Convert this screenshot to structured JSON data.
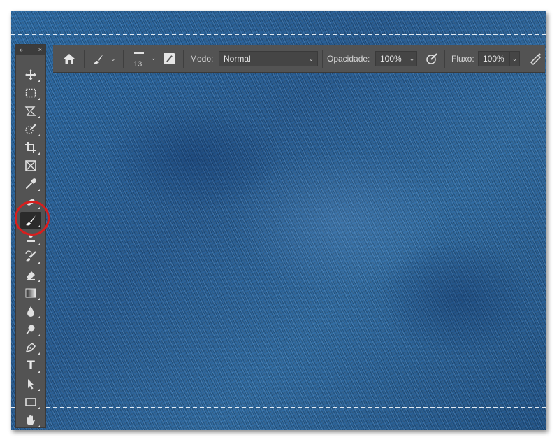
{
  "canvas": {
    "stitch_color": "#f0f5fa",
    "denim_color": "#2f6ea8"
  },
  "toolbar": {
    "header_left": "»",
    "header_right": "×",
    "tools": [
      {
        "icon": "move-icon"
      },
      {
        "icon": "marquee-icon"
      },
      {
        "icon": "lasso-icon"
      },
      {
        "icon": "quick-selection-icon"
      },
      {
        "icon": "crop-icon"
      },
      {
        "icon": "frame-icon"
      },
      {
        "icon": "eyedropper-icon"
      },
      {
        "icon": "healing-brush-icon"
      },
      {
        "icon": "brush-icon",
        "active": true
      },
      {
        "icon": "clone-stamp-icon"
      },
      {
        "icon": "history-brush-icon"
      },
      {
        "icon": "eraser-icon"
      },
      {
        "icon": "gradient-icon"
      },
      {
        "icon": "blur-icon"
      },
      {
        "icon": "dodge-icon"
      },
      {
        "icon": "pen-icon"
      },
      {
        "text_label": "T",
        "icon": "type-icon"
      },
      {
        "icon": "path-selection-icon"
      },
      {
        "icon": "rectangle-icon"
      },
      {
        "icon": "hand-icon"
      }
    ],
    "highlight_color": "#d81e1e"
  },
  "options_bar": {
    "brush_size": "13",
    "mode_label": "Modo:",
    "mode_value": "Normal",
    "opacity_label": "Opacidade:",
    "opacity_value": "100%",
    "flow_label": "Fluxo:",
    "flow_value": "100%"
  }
}
